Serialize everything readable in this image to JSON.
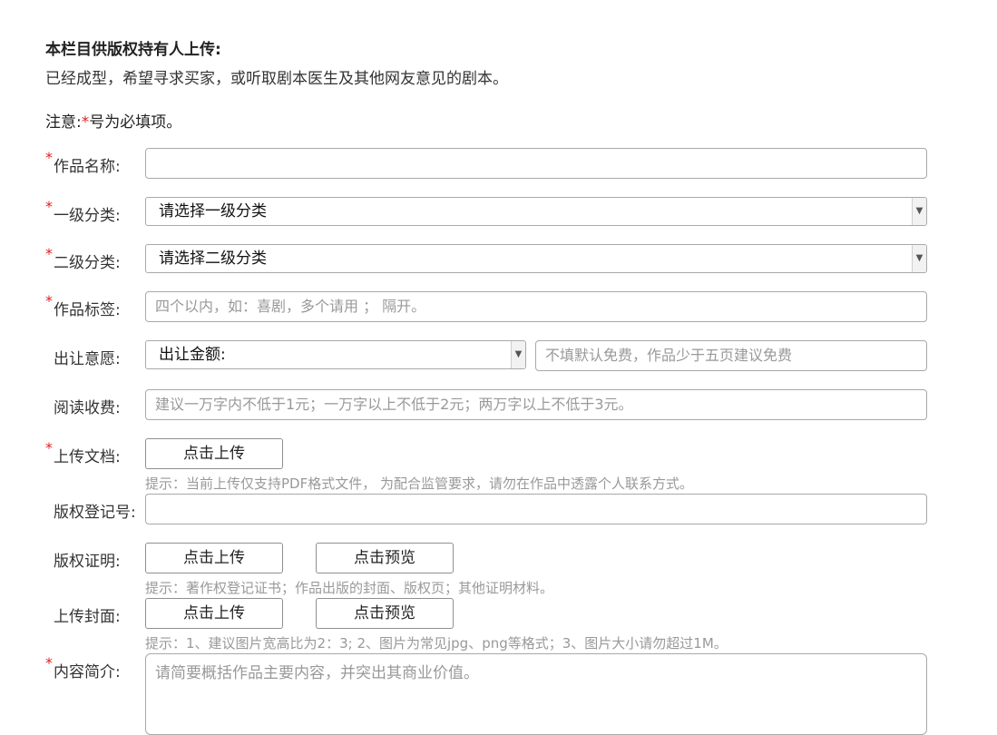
{
  "intro": {
    "heading": "本栏目供版权持有人上传:",
    "description": "已经成型，希望寻求买家，或听取剧本医生及其他网友意见的剧本。"
  },
  "notice": {
    "prefix": "注意:",
    "star": "*",
    "suffix": "号为必填项。"
  },
  "fields": {
    "title": {
      "label": "作品名称:",
      "value": ""
    },
    "category1": {
      "label": "一级分类:",
      "selected": "请选择一级分类"
    },
    "category2": {
      "label": "二级分类:",
      "selected": "请选择二级分类"
    },
    "tags": {
      "label": "作品标签:",
      "placeholder": "四个以内，如：喜剧，多个请用 ； 隔开。"
    },
    "transfer": {
      "label": "出让意愿:",
      "selected": "出让金额:",
      "placeholder": "不填默认免费，作品少于五页建议免费"
    },
    "reading_fee": {
      "label": "阅读收费:",
      "placeholder": "建议一万字内不低于1元；一万字以上不低于2元；两万字以上不低于3元。"
    },
    "upload_doc": {
      "label": "上传文档:",
      "button": "点击上传",
      "hint": "提示：当前上传仅支持PDF格式文件，  为配合监管要求，请勿在作品中透露个人联系方式。"
    },
    "copyright_reg": {
      "label": "版权登记号:",
      "value": ""
    },
    "copyright_proof": {
      "label": "版权证明:",
      "upload_button": "点击上传",
      "preview_button": "点击预览",
      "hint": "提示：著作权登记证书；作品出版的封面、版权页；其他证明材料。"
    },
    "cover": {
      "label": "上传封面:",
      "upload_button": "点击上传",
      "preview_button": "点击预览",
      "hint": "提示：1、建议图片宽高比为2：3; 2、图片为常见jpg、png等格式；3、图片大小请勿超过1M。"
    },
    "summary": {
      "label": "内容简介:",
      "placeholder": "请简要概括作品主要内容，并突出其商业价值。"
    }
  },
  "required_mark": "*",
  "colors": {
    "required": "#e02020",
    "hint": "#999999",
    "border": "#a9a9a9"
  }
}
